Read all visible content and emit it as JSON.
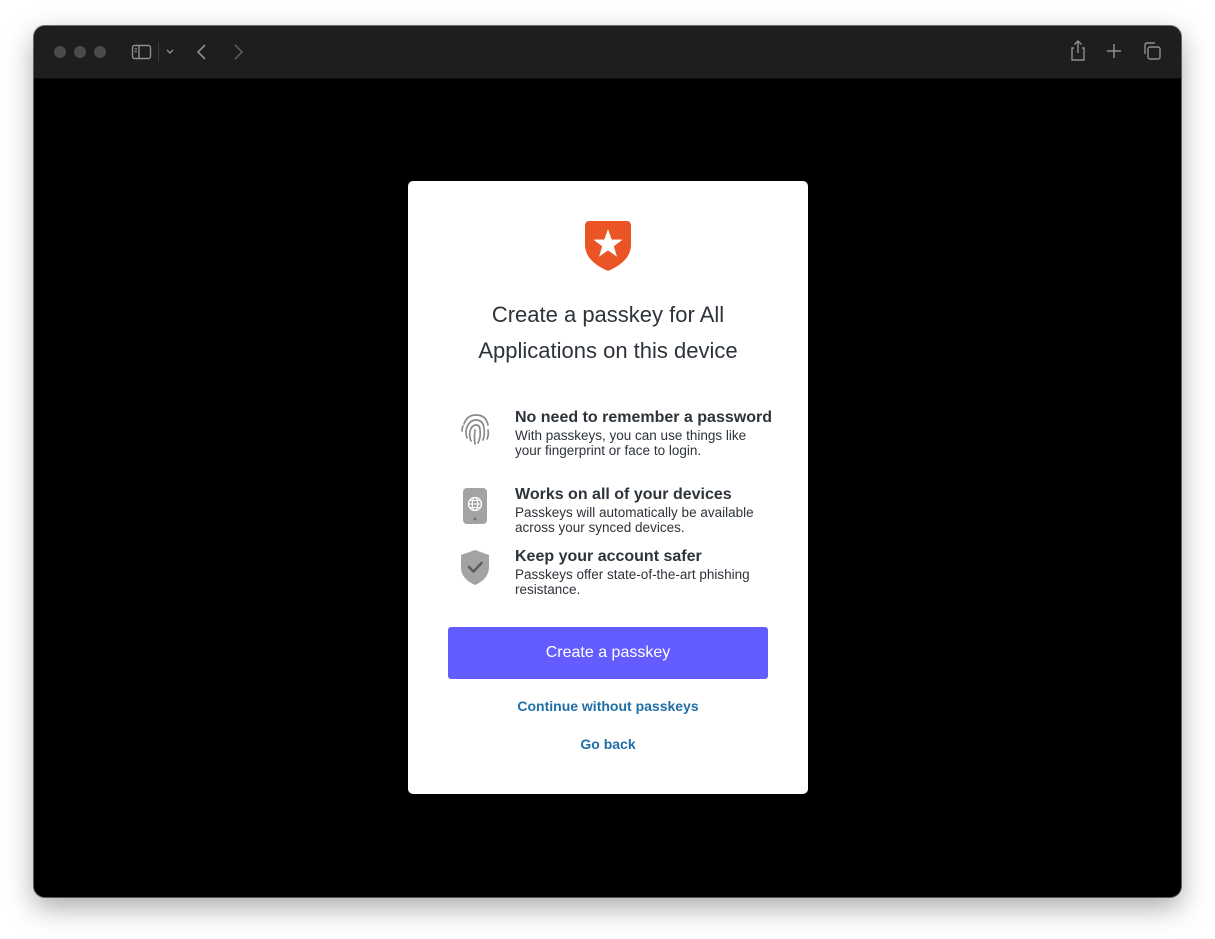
{
  "browser": {
    "buttons": {
      "sidebar": "sidebar-icon",
      "back": "chevron-left-icon",
      "forward": "chevron-right-icon",
      "share": "share-icon",
      "new_tab": "plus-icon",
      "tab_overview": "tabs-icon"
    }
  },
  "dialog": {
    "logo": "auth0-shield-star-icon",
    "title": "Create a passkey for All Applications on this device",
    "features": [
      {
        "icon": "fingerprint-icon",
        "heading": "No need to remember a password",
        "description": "With passkeys, you can use things like your fingerprint or face to login."
      },
      {
        "icon": "device-globe-icon",
        "heading": "Works on all of your devices",
        "description": "Passkeys will automatically be available across your synced devices."
      },
      {
        "icon": "shield-check-icon",
        "heading": "Keep your account safer",
        "description": "Passkeys offer state-of-the-art phishing resistance."
      }
    ],
    "primary_button": "Create a passkey",
    "secondary_link": "Continue without passkeys",
    "back_link": "Go back"
  },
  "colors": {
    "brand_orange": "#eb5424",
    "primary": "#635dff",
    "link": "#1f6fa6",
    "text": "#2d333a",
    "icon_gray": "#a3a3a3"
  }
}
